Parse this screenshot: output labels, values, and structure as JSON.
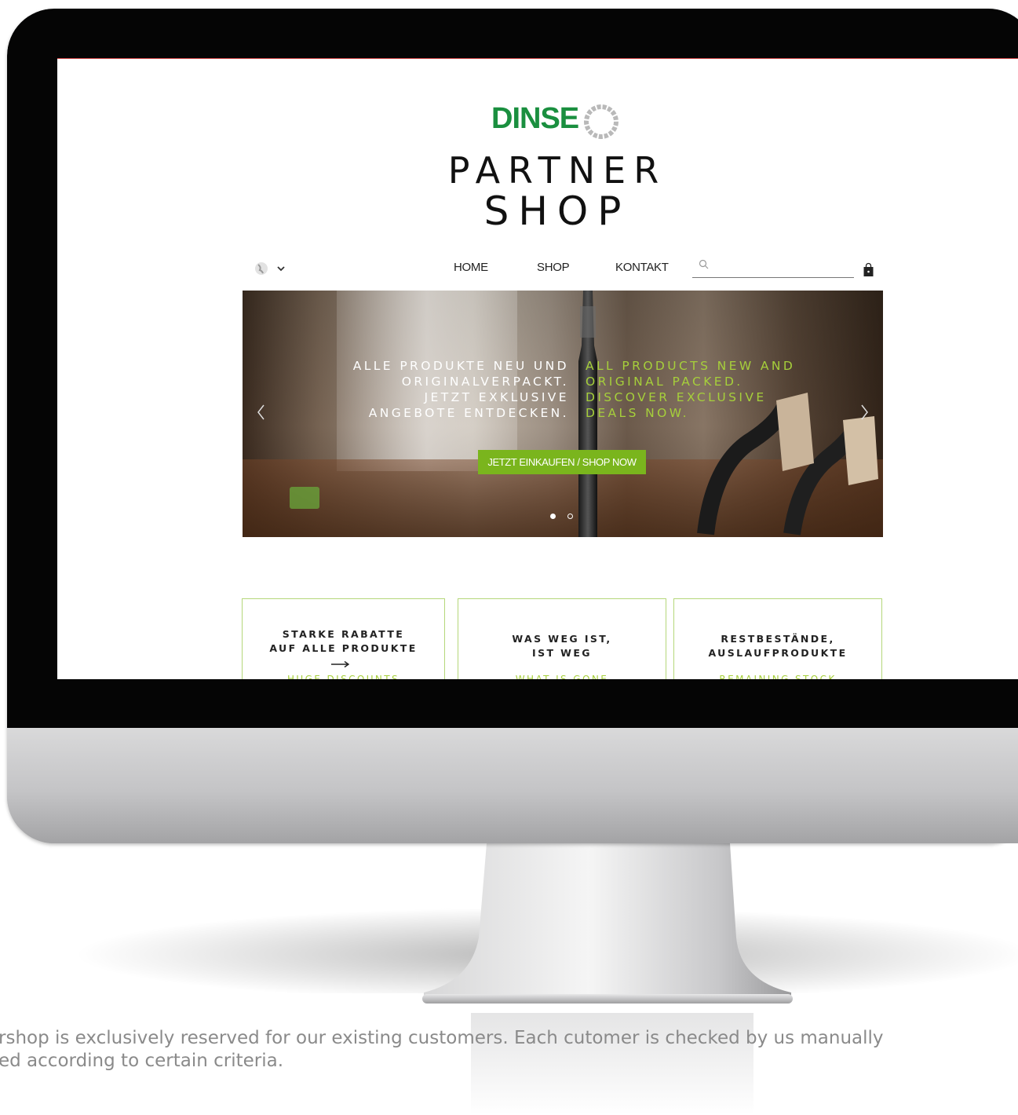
{
  "brand": {
    "logo_text": "DINSE",
    "logo_color": "#1a8f3f",
    "title_line1": "PARTNER",
    "title_line2": "SHOP"
  },
  "nav": {
    "language_icon": "globe-icon",
    "items": [
      {
        "label": "HOME"
      },
      {
        "label": "SHOP"
      },
      {
        "label": "KONTAKT"
      }
    ],
    "search_value": "",
    "cart_icon": "shopping-bag-icon"
  },
  "hero": {
    "de_lines": [
      "ALLE PRODUKTE NEU UND",
      "ORIGINALVERPACKT.",
      "JETZT EXKLUSIVE",
      "ANGEBOTE ENTDECKEN."
    ],
    "en_lines": [
      "ALL PRODUCTS NEW AND",
      "ORIGINAL PACKED.",
      "DISCOVER EXCLUSIVE",
      "DEALS NOW."
    ],
    "cta_label": "JETZT EINKAUFEN / SHOP NOW",
    "accent_color": "#7ab51d",
    "slides_total": 2,
    "slide_active": 1
  },
  "features": [
    {
      "title_lines": [
        "STARKE RABATTE",
        "AUF ALLE PRODUKTE"
      ],
      "sub": "HUGE DISCOUNTS"
    },
    {
      "title_lines": [
        "WAS WEG IST,",
        "IST WEG"
      ],
      "sub": "WHAT IS GONE"
    },
    {
      "title_lines": [
        "RESTBESTÄNDE,",
        "AUSLAUFPRODUKTE"
      ],
      "sub": "REMAINING STOCK"
    }
  ],
  "caption": {
    "line1": "rshop is exclusively reserved for our existing customers. Each cutomer is checked by us manually",
    "line2": "ed according to certain criteria."
  }
}
